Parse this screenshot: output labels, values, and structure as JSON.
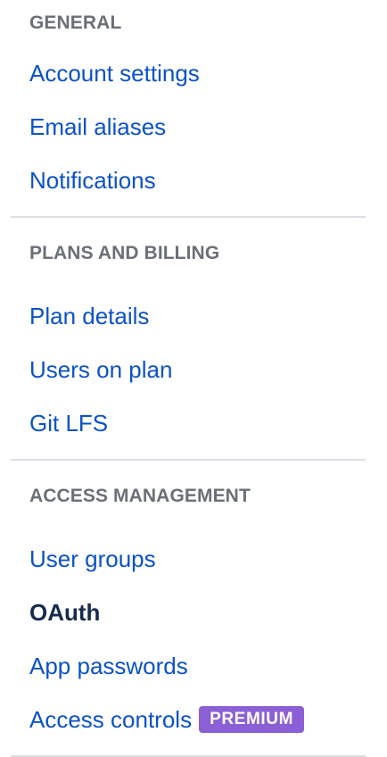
{
  "general": {
    "heading": "GENERAL",
    "items": [
      "Account settings",
      "Email aliases",
      "Notifications"
    ]
  },
  "plans_billing": {
    "heading": "PLANS AND BILLING",
    "items": [
      "Plan details",
      "Users on plan",
      "Git LFS"
    ]
  },
  "access_management": {
    "heading": "ACCESS MANAGEMENT",
    "items": [
      "User groups",
      "OAuth",
      "App passwords",
      "Access controls"
    ],
    "active_item": "OAuth",
    "premium_badge": "PREMIUM"
  },
  "colors": {
    "link": "#0b52c8",
    "heading": "#6b6f77",
    "active": "#172b4d",
    "badge": "#8b5fd6",
    "divider": "#dcdfe4"
  }
}
